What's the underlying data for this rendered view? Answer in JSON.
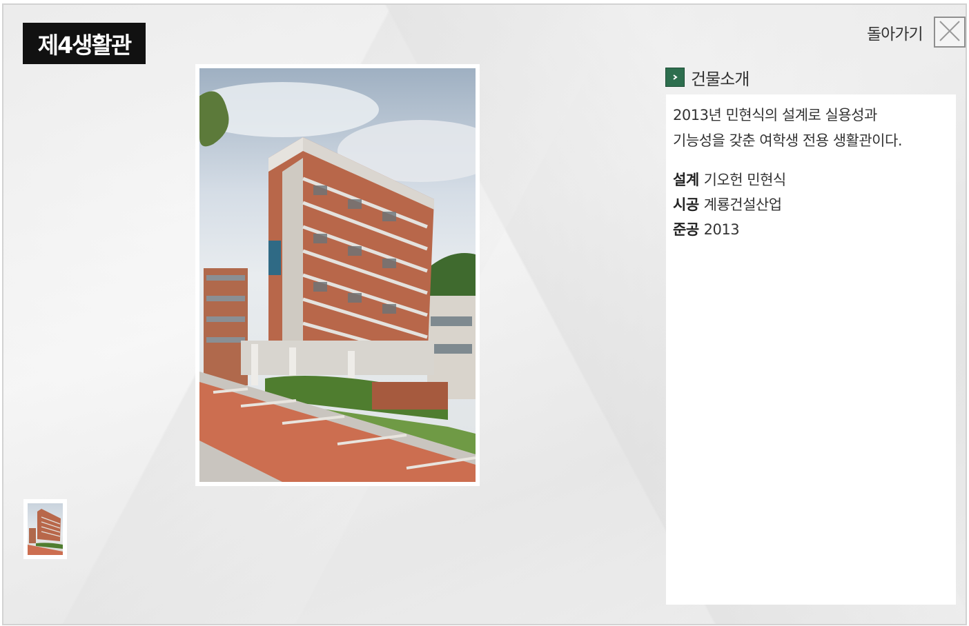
{
  "page": {
    "title": "제4생활관"
  },
  "header": {
    "back_label": "돌아가기",
    "close_icon": "close-x-icon"
  },
  "gallery": {
    "main_photo_icon": "building-photo",
    "thumbnails": [
      {
        "icon": "building-thumbnail"
      }
    ]
  },
  "info": {
    "section_icon": "chevron-right-icon",
    "section_title": "건물소개",
    "description_line1": "2013년 민현식의 설계로 실용성과",
    "description_line2": "기능성을 갖춘 여학생 전용 생활관이다.",
    "specs": [
      {
        "key": "설계",
        "value": "기오헌 민현식"
      },
      {
        "key": "시공",
        "value": "계룡건설산업"
      },
      {
        "key": "준공",
        "value": "2013"
      }
    ]
  },
  "colors": {
    "title_bg": "#111111",
    "section_icon_bg": "#2d6e4e",
    "brick": "#b8674a"
  }
}
